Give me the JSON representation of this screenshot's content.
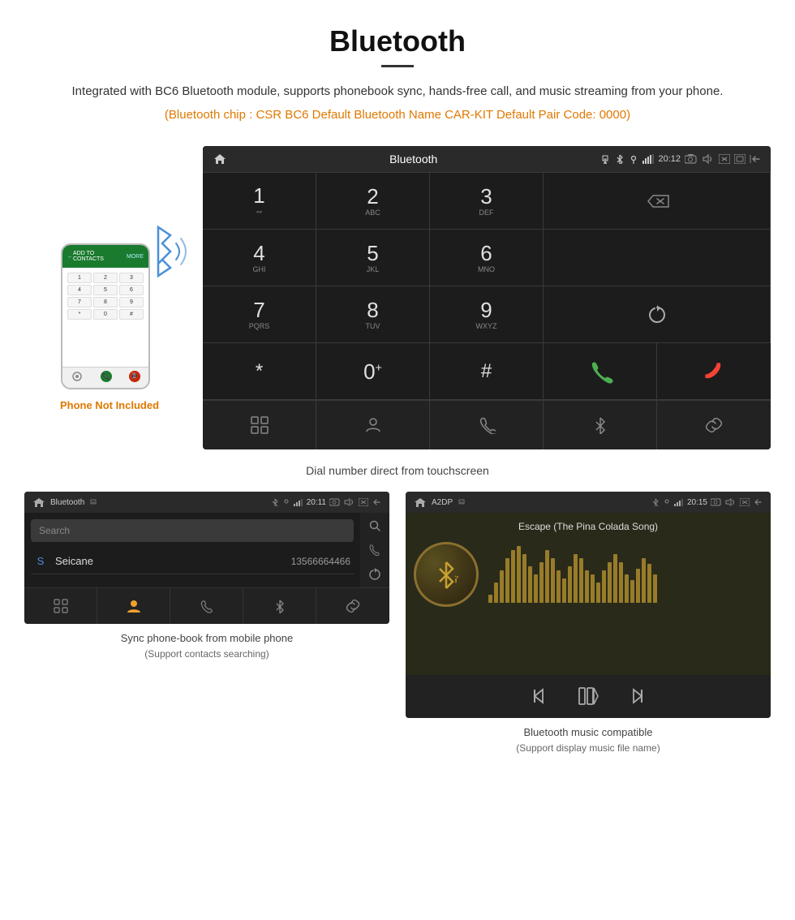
{
  "header": {
    "title": "Bluetooth",
    "description": "Integrated with BC6 Bluetooth module, supports phonebook sync, hands-free call, and music streaming from your phone.",
    "specs": "(Bluetooth chip : CSR BC6   Default Bluetooth Name CAR-KIT    Default Pair Code: 0000)"
  },
  "phone_label": "Phone Not Included",
  "dialpad": {
    "statusbar": {
      "title": "Bluetooth",
      "time": "20:12"
    },
    "keys": [
      {
        "num": "1",
        "letters": "∾∾",
        "row": 0,
        "col": 0
      },
      {
        "num": "2",
        "letters": "ABC",
        "row": 0,
        "col": 1
      },
      {
        "num": "3",
        "letters": "DEF",
        "row": 0,
        "col": 2
      },
      {
        "num": "4",
        "letters": "GHI",
        "row": 1,
        "col": 0
      },
      {
        "num": "5",
        "letters": "JKL",
        "row": 1,
        "col": 1
      },
      {
        "num": "6",
        "letters": "MNO",
        "row": 1,
        "col": 2
      },
      {
        "num": "7",
        "letters": "PQRS",
        "row": 2,
        "col": 0
      },
      {
        "num": "8",
        "letters": "TUV",
        "row": 2,
        "col": 1
      },
      {
        "num": "9",
        "letters": "WXYZ",
        "row": 2,
        "col": 2
      },
      {
        "num": "*",
        "letters": "",
        "row": 3,
        "col": 0
      },
      {
        "num": "0+",
        "letters": "",
        "row": 3,
        "col": 1
      },
      {
        "num": "#",
        "letters": "",
        "row": 3,
        "col": 2
      }
    ],
    "caption": "Dial number direct from touchscreen"
  },
  "phonebook": {
    "statusbar_title": "Bluetooth",
    "statusbar_time": "20:11",
    "search_placeholder": "Search",
    "contact_letter": "S",
    "contact_name": "Seicane",
    "contact_number": "13566664466",
    "caption_line1": "Sync phone-book from mobile phone",
    "caption_line2": "(Support contacts searching)"
  },
  "music": {
    "statusbar_title": "A2DP",
    "statusbar_time": "20:15",
    "song_title": "Escape (The Pina Colada Song)",
    "caption_line1": "Bluetooth music compatible",
    "caption_line2": "(Support display music file name)"
  },
  "visualizer_bars": [
    10,
    25,
    40,
    55,
    65,
    70,
    60,
    45,
    35,
    50,
    65,
    55,
    40,
    30,
    45,
    60,
    55,
    40,
    35,
    25,
    40,
    50,
    60,
    50,
    35,
    28,
    42,
    55,
    48,
    35
  ]
}
